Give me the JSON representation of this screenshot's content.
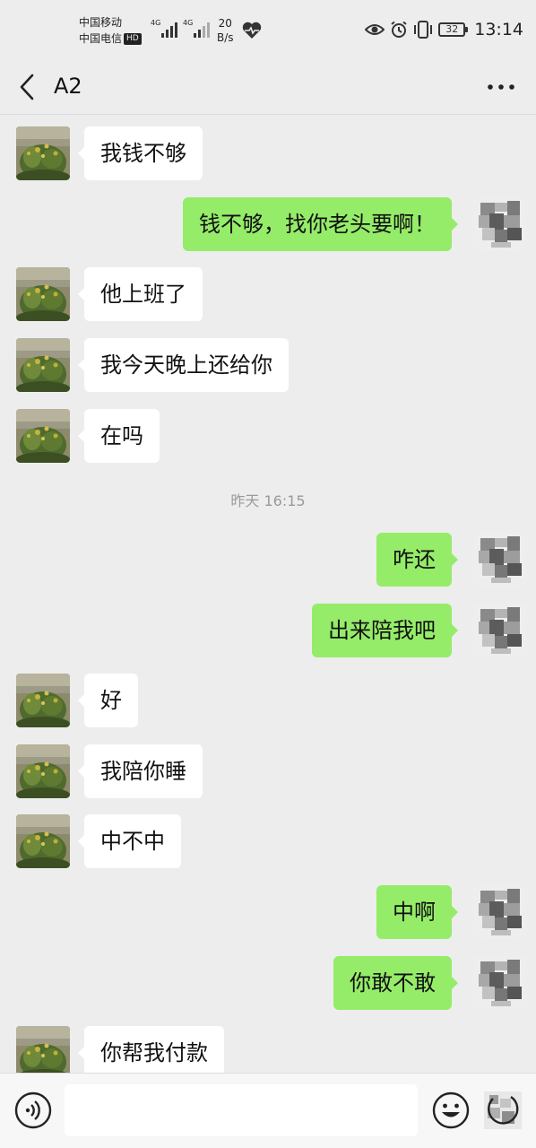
{
  "status_bar": {
    "carrier_1": "中国移动",
    "carrier_2": "中国电信",
    "hd_badge": "HD",
    "network_1": "4G",
    "network_2": "4G",
    "speed_value": "20",
    "speed_unit": "B/s",
    "battery": "32",
    "time": "13:14"
  },
  "header": {
    "title": "A2"
  },
  "timestamp": "昨天 16:15",
  "messages": [
    {
      "side": "in",
      "text": "我钱不够"
    },
    {
      "side": "out",
      "text": "钱不够，找你老头要啊！"
    },
    {
      "side": "in",
      "text": "他上班了"
    },
    {
      "side": "in",
      "text": "我今天晚上还给你"
    },
    {
      "side": "in",
      "text": "在吗"
    },
    {
      "side": "out",
      "text": "咋还"
    },
    {
      "side": "out",
      "text": "出来陪我吧"
    },
    {
      "side": "in",
      "text": "好"
    },
    {
      "side": "in",
      "text": "我陪你睡"
    },
    {
      "side": "in",
      "text": "中不中"
    },
    {
      "side": "out",
      "text": "中啊"
    },
    {
      "side": "out",
      "text": "你敢不敢"
    },
    {
      "side": "in",
      "text": "你帮我付款"
    }
  ],
  "input": {
    "value": "",
    "placeholder": ""
  },
  "colors": {
    "background": "#ededed",
    "incoming_bubble": "#ffffff",
    "outgoing_bubble": "#95ec69"
  }
}
